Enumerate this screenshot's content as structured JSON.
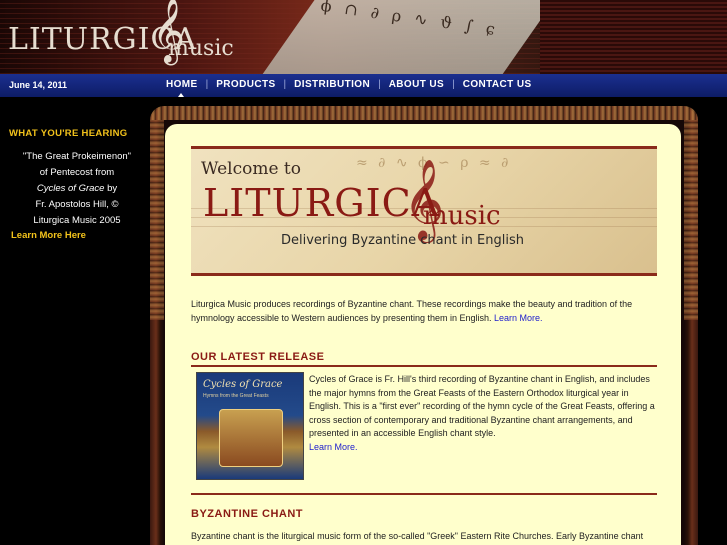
{
  "header": {
    "logo_main": "LITURGICA",
    "logo_music": "music",
    "decor_notes": "ϕ ∩ ∂ ρ ∿ ϑ ∫ ɕ"
  },
  "navbar": {
    "date": "June 14, 2011",
    "items": [
      {
        "label": "HOME",
        "active": true
      },
      {
        "label": "PRODUCTS",
        "active": false
      },
      {
        "label": "DISTRIBUTION",
        "active": false
      },
      {
        "label": "ABOUT US",
        "active": false
      },
      {
        "label": "CONTACT US",
        "active": false
      }
    ],
    "separator": "|"
  },
  "sidebar": {
    "heading": "WHAT YOU'RE HEARING",
    "line1": "\"The Great Prokeimenon\"",
    "line2": "of Pentecost from",
    "line3_italic": "Cycles of Grace",
    "line3_rest": " by",
    "line4": "Fr. Apostolos Hill, ©",
    "line5": "Liturgica Music 2005",
    "link": "Learn More Here"
  },
  "banner": {
    "welcome": "Welcome to",
    "title": "LITURGICA",
    "music": "music",
    "tagline": "Delivering Byzantine chant in English",
    "decor_notes": "≈ ∂ ∿ ϕ ∽ ρ ≈ ∂"
  },
  "intro": {
    "text": "Liturgica Music produces recordings of Byzantine chant. These recordings make the beauty and tradition of the hymnology accessible to Western audiences by presenting them in English. ",
    "link": "Learn More."
  },
  "latest_release": {
    "heading": "OUR LATEST RELEASE",
    "album_title": "Cycles of Grace",
    "album_subtitle": "Hymns from the Great Feasts",
    "text": "Cycles of Grace is Fr. Hill's third recording of Byzantine chant in English, and includes the major hymns from the Great Feasts of the Eastern Orthodox liturgical year in English. This is a \"first ever\" recording of the hymn cycle of the Great Feasts, offering a cross section of contemporary and traditional Byzantine chant arrangements, and presented in an accessible English chant style.",
    "link": "Learn More."
  },
  "byzantine": {
    "heading": "BYZANTINE CHANT",
    "text": "Byzantine chant is the liturgical music form of the so-called \"Greek\" Eastern Rite Churches. Early Byzantine chant was the original form of liturgical music in the Christian Church, developing from the interplay of Greek"
  },
  "colors": {
    "nav_blue": "#1b2f8f",
    "accent_gold": "#f2c21b",
    "heading_red": "#8a1a14",
    "content_bg": "#ffffcc",
    "link_blue": "#2222cc"
  }
}
